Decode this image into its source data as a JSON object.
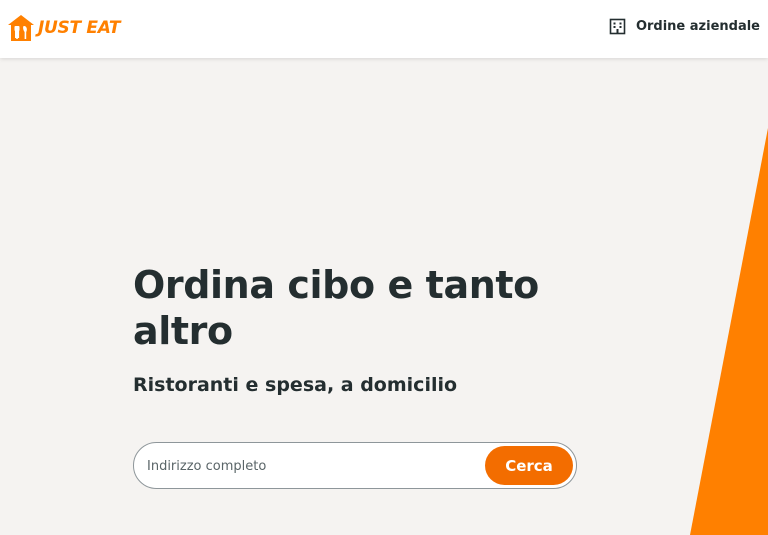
{
  "header": {
    "brand": "JUST EAT",
    "business_label": "Ordine aziendale",
    "business_icon": "building-icon"
  },
  "hero": {
    "title": "Ordina cibo e tanto altro",
    "subtitle": "Ristoranti e spesa, a domicilio"
  },
  "search": {
    "placeholder": "Indirizzo completo",
    "value": "",
    "button_label": "Cerca"
  },
  "colors": {
    "brand_orange": "#ff8000",
    "button_orange": "#f36d00",
    "background": "#f5f3f1",
    "text": "#242e30"
  }
}
